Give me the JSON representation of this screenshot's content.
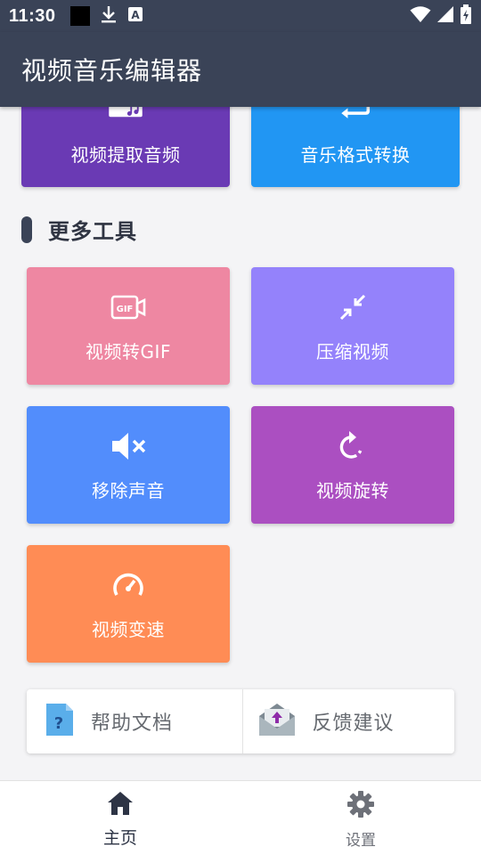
{
  "status_bar": {
    "time": "11:30",
    "icons": [
      "notification-square-icon",
      "download-icon",
      "keyboard-a-icon",
      "wifi-icon",
      "signal-icon",
      "battery-icon"
    ]
  },
  "app_bar": {
    "title": "视频音乐编辑器"
  },
  "top_tiles": [
    {
      "label": "视频提取音频",
      "icon": "film-music-icon",
      "color": "#6a3ab4"
    },
    {
      "label": "音乐格式转换",
      "icon": "repeat-icon",
      "color": "#2196f3"
    }
  ],
  "section": {
    "title": "更多工具"
  },
  "tools": [
    {
      "label": "视频转GIF",
      "icon": "gif-video-icon",
      "color": "#ee87a2"
    },
    {
      "label": "压缩视频",
      "icon": "compress-arrows-icon",
      "color": "#9482fb"
    },
    {
      "label": "移除声音",
      "icon": "mute-icon",
      "color": "#528dfc"
    },
    {
      "label": "视频旋转",
      "icon": "rotate-icon",
      "color": "#ab4fc1"
    },
    {
      "label": "视频变速",
      "icon": "speedometer-icon",
      "color": "#ff8c55"
    }
  ],
  "links": [
    {
      "label": "帮助文档",
      "icon": "help-document-icon"
    },
    {
      "label": "反馈建议",
      "icon": "feedback-mail-icon"
    }
  ],
  "bottom_nav": [
    {
      "label": "主页",
      "icon": "home-icon",
      "active": true
    },
    {
      "label": "设置",
      "icon": "gear-icon",
      "active": false
    }
  ]
}
